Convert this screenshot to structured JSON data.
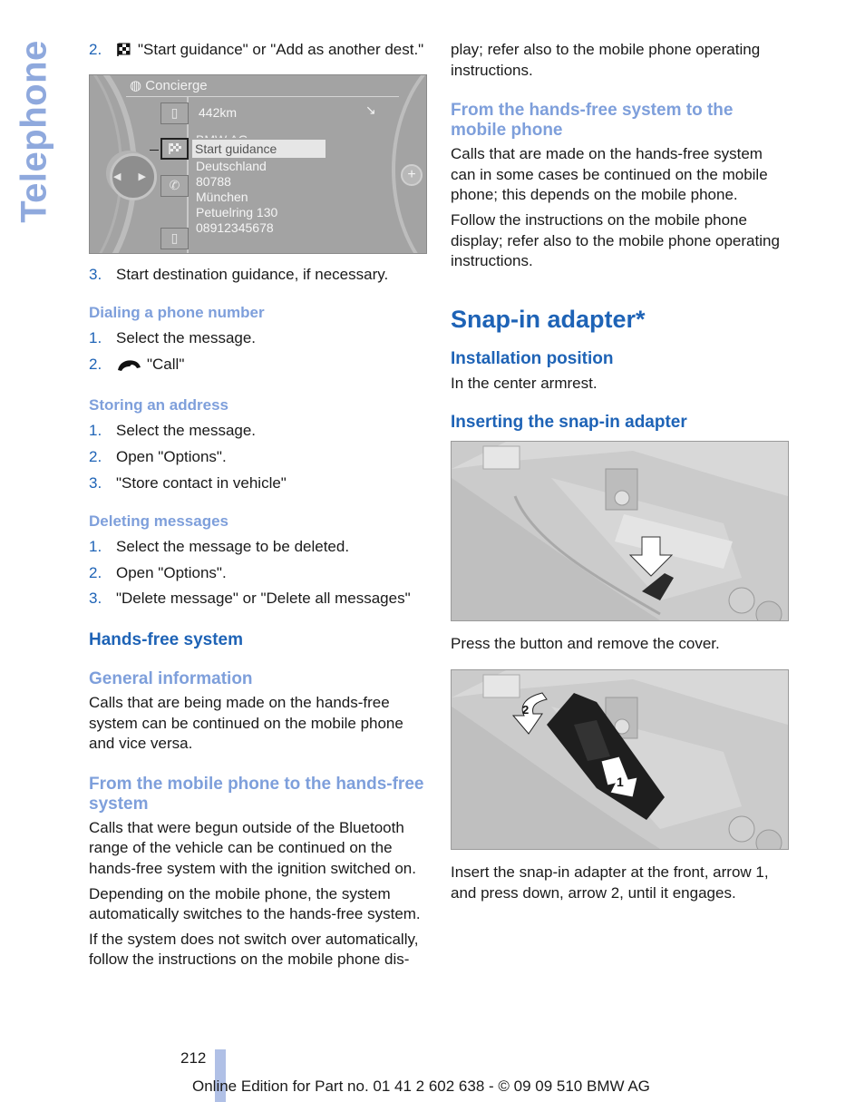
{
  "side_tab": {
    "label": "Telephone"
  },
  "left_column": {
    "step_2_start": {
      "num": "2.",
      "icon": "checkered-flag-icon",
      "text": "\"Start guidance\" or \"Add as another dest.\""
    },
    "screen": {
      "title_icon": "concierge-globe-icon",
      "title": "Concierge",
      "distance": "442km",
      "direction_icon": "arrow-down-right-icon",
      "partial_hidden_line": "BMW AG",
      "highlighted_item": "Start guidance",
      "address_lines": [
        "Deutschland",
        "80788",
        "München",
        "Petuelring 130",
        "08912345678"
      ],
      "side_icons": [
        "book-back-icon",
        "checkered-flag-icon",
        "phone-handset-icon",
        "book-forward-icon"
      ],
      "knob_arrows": "◀ ▶",
      "plus_button": "+"
    },
    "step_3_dest": {
      "num": "3.",
      "text": "Start destination guidance, if necessary."
    },
    "dialing": {
      "heading": "Dialing a phone number",
      "steps": [
        {
          "num": "1.",
          "text": "Select the message."
        },
        {
          "num": "2.",
          "icon": "phone-handset-icon",
          "text": "\"Call\""
        }
      ]
    },
    "storing": {
      "heading": "Storing an address",
      "steps": [
        {
          "num": "1.",
          "text": "Select the message."
        },
        {
          "num": "2.",
          "text": "Open \"Options\"."
        },
        {
          "num": "3.",
          "text": "\"Store contact in vehicle\""
        }
      ]
    },
    "deleting": {
      "heading": "Deleting messages",
      "steps": [
        {
          "num": "1.",
          "text": "Select the message to be deleted."
        },
        {
          "num": "2.",
          "text": "Open \"Options\"."
        },
        {
          "num": "3.",
          "text": "\"Delete message\" or \"Delete all messages\""
        }
      ]
    },
    "hands_free": {
      "heading": "Hands-free system",
      "general_heading": "General information",
      "general_text": "Calls that are being made on the hands-free system can be continued on the mobile phone and vice versa.",
      "from_mobile_heading": "From the mobile phone to the hands-free system",
      "from_mobile_paras": [
        "Calls that were begun outside of the Bluetooth range of the vehicle can be continued on the hands-free system with the ignition switched on.",
        "Depending on the mobile phone, the system automatically switches to the hands-free system.",
        "If the system does not switch over automatically, follow the instructions on the mobile phone dis-"
      ]
    }
  },
  "right_column": {
    "continued_text": "play; refer also to the mobile phone operating instructions.",
    "from_hf_heading": "From the hands-free system to the mobile phone",
    "from_hf_paras": [
      "Calls that are made on the hands-free system can in some cases be continued on the mobile phone; this depends on the mobile phone.",
      "Follow the instructions on the mobile phone display; refer also to the mobile phone operating instructions."
    ],
    "snap_heading": "Snap-in adapter*",
    "install_heading": "Installation position",
    "install_text": "In the center armrest.",
    "insert_heading": "Inserting the snap-in adapter",
    "caption_1": "Press the button and remove the cover.",
    "caption_2": "Insert the snap-in adapter at the front, arrow 1, and press down, arrow 2, until it engages.",
    "illus_2_labels": [
      "1",
      "2"
    ]
  },
  "footer": {
    "page_number": "212",
    "edition": "Online Edition for Part no. 01 41 2 602 638 - © 09 09 510 BMW AG"
  },
  "colors": {
    "heading_dark": "#1e63b6",
    "heading_light": "#7e9fdb",
    "side_tab": "#8fa9dd",
    "footer_bar": "#b0c0e6"
  }
}
